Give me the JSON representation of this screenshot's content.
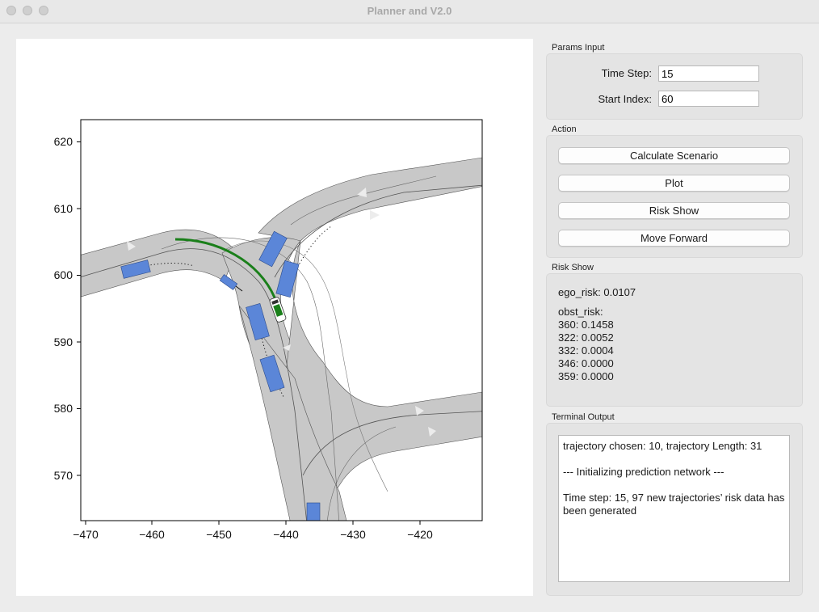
{
  "window": {
    "title": "Planner and V2.0"
  },
  "plot": {
    "x_ticks": [
      "−470",
      "−460",
      "−450",
      "−440",
      "−430",
      "−420"
    ],
    "y_ticks": [
      "620",
      "610",
      "600",
      "590",
      "580",
      "570"
    ],
    "colors": {
      "road": "#c8c8c8",
      "vehicle": "#5b86d8",
      "ego_path": "#1a7f1a"
    }
  },
  "params": {
    "section_label": "Params Input",
    "time_step_label": "Time Step:",
    "time_step_value": "15",
    "start_index_label": "Start Index:",
    "start_index_value": "60"
  },
  "action": {
    "section_label": "Action",
    "calculate_label": "Calculate Scenario",
    "plot_label": "Plot",
    "risk_show_label": "Risk Show",
    "move_forward_label": "Move Forward"
  },
  "risk": {
    "section_label": "Risk Show",
    "ego_risk": "ego_risk: 0.0107",
    "obst_risk_label": "obst_risk:",
    "items": [
      "360: 0.1458",
      "322: 0.0052",
      "332: 0.0004",
      "346: 0.0000",
      "359: 0.0000"
    ]
  },
  "terminal": {
    "section_label": "Terminal Output",
    "text": "trajectory chosen: 10, trajectory Length: 31\n\n--- Initializing prediction network ---\n\nTime step: 15, 97 new trajectories’ risk data has been generated"
  }
}
